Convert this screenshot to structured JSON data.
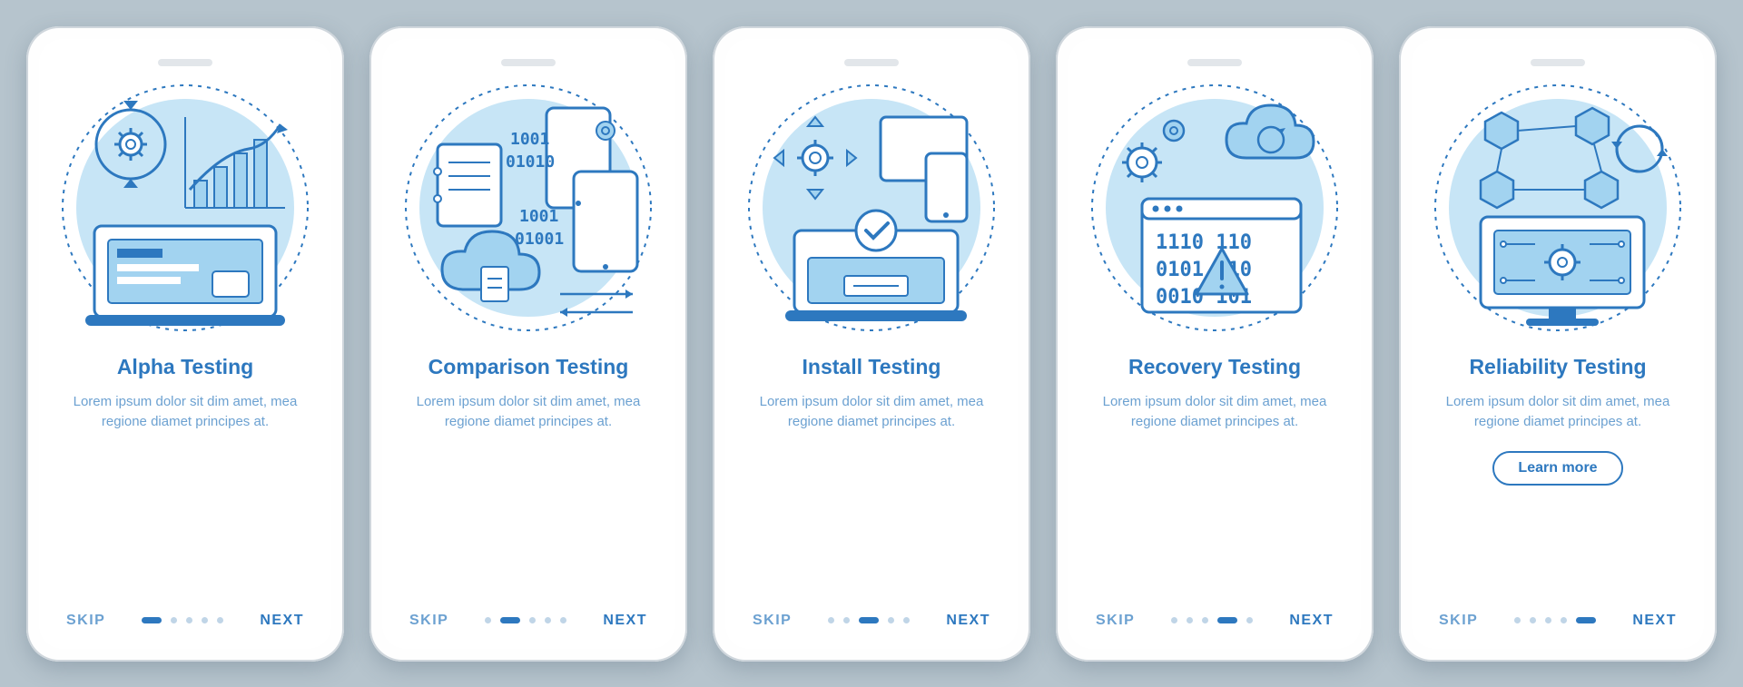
{
  "common": {
    "skip": "SKIP",
    "next": "NEXT",
    "description": "Lorem ipsum dolor sit dim amet, mea regione diamet principes at.",
    "learn_more": "Learn more"
  },
  "screens": [
    {
      "title": "Alpha Testing",
      "has_cta": false,
      "active_dot": 0
    },
    {
      "title": "Comparison Testing",
      "has_cta": false,
      "active_dot": 1
    },
    {
      "title": "Install Testing",
      "has_cta": false,
      "active_dot": 2
    },
    {
      "title": "Recovery Testing",
      "has_cta": false,
      "active_dot": 3
    },
    {
      "title": "Reliability Testing",
      "has_cta": true,
      "active_dot": 4
    }
  ],
  "colors": {
    "primary": "#2d78bf",
    "light": "#a2d3f0",
    "accent": "#6ca1d1",
    "bg_circle": "#a2d3f0"
  }
}
